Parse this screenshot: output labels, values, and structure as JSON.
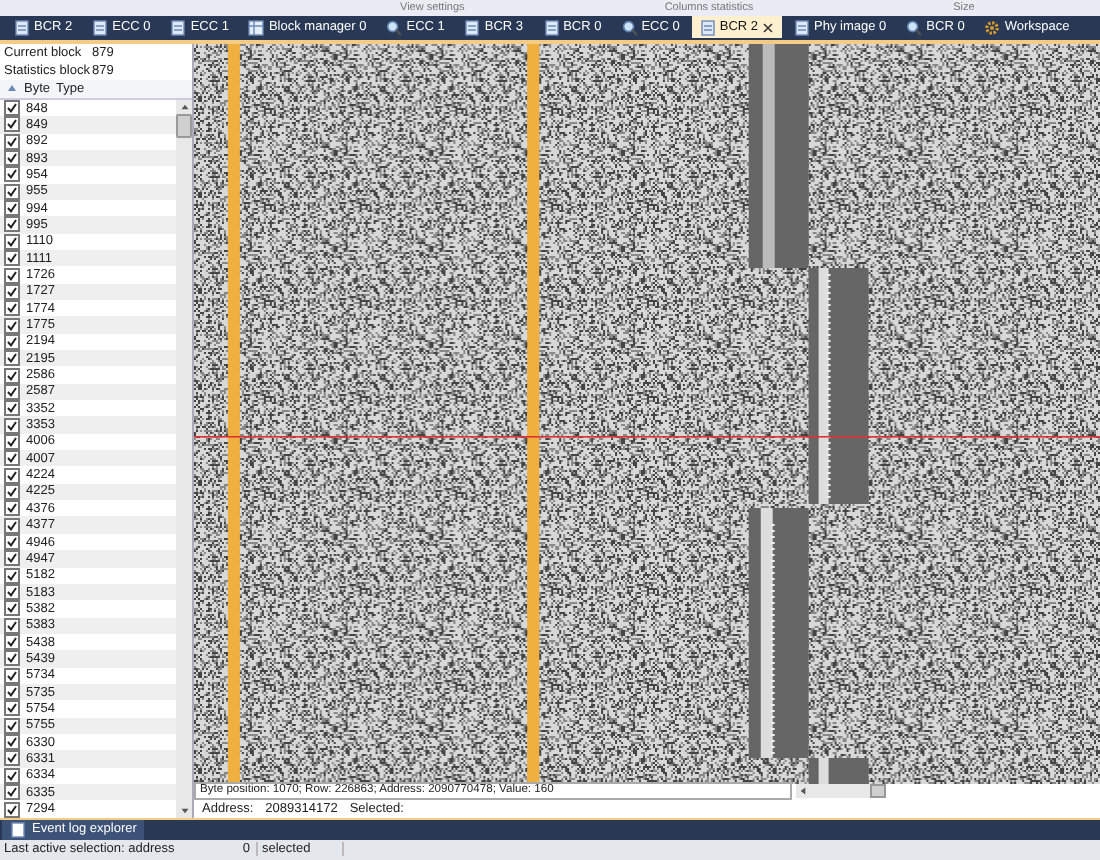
{
  "ribbon_groups": [
    "View settings",
    "Columns statistics",
    "Size"
  ],
  "tabs": [
    {
      "label": "BCR 2",
      "kind": "doc",
      "selected": false
    },
    {
      "label": "ECC 0",
      "kind": "doc",
      "selected": false
    },
    {
      "label": "ECC 1",
      "kind": "doc",
      "selected": false
    },
    {
      "label": "Block manager 0",
      "kind": "block",
      "selected": false
    },
    {
      "label": "ECC 1",
      "kind": "search",
      "selected": false
    },
    {
      "label": "BCR 3",
      "kind": "doc",
      "selected": false
    },
    {
      "label": "BCR 0",
      "kind": "doc",
      "selected": false
    },
    {
      "label": "ECC 0",
      "kind": "search",
      "selected": false
    },
    {
      "label": "BCR 2",
      "kind": "doc",
      "selected": true
    },
    {
      "label": "Phy image 0",
      "kind": "doc",
      "selected": false
    },
    {
      "label": "BCR 0",
      "kind": "search",
      "selected": false
    },
    {
      "label": "Workspace",
      "kind": "gear",
      "selected": false
    }
  ],
  "block_info": [
    {
      "label": "Current block",
      "value": "879"
    },
    {
      "label": "Statistics block",
      "value": "879"
    }
  ],
  "columns": [
    "Byte",
    "Type"
  ],
  "bytes": [
    {
      "value": "848",
      "checked": true
    },
    {
      "value": "849",
      "checked": true
    },
    {
      "value": "892",
      "checked": true
    },
    {
      "value": "893",
      "checked": true
    },
    {
      "value": "954",
      "checked": true
    },
    {
      "value": "955",
      "checked": true
    },
    {
      "value": "994",
      "checked": true
    },
    {
      "value": "995",
      "checked": true
    },
    {
      "value": "1110",
      "checked": true
    },
    {
      "value": "1111",
      "checked": true
    },
    {
      "value": "1726",
      "checked": true
    },
    {
      "value": "1727",
      "checked": true
    },
    {
      "value": "1774",
      "checked": true
    },
    {
      "value": "1775",
      "checked": true
    },
    {
      "value": "2194",
      "checked": true
    },
    {
      "value": "2195",
      "checked": true
    },
    {
      "value": "2586",
      "checked": true
    },
    {
      "value": "2587",
      "checked": true
    },
    {
      "value": "3352",
      "checked": true
    },
    {
      "value": "3353",
      "checked": true
    },
    {
      "value": "4006",
      "checked": true
    },
    {
      "value": "4007",
      "checked": true
    },
    {
      "value": "4224",
      "checked": true
    },
    {
      "value": "4225",
      "checked": true
    },
    {
      "value": "4376",
      "checked": true
    },
    {
      "value": "4377",
      "checked": true
    },
    {
      "value": "4946",
      "checked": true
    },
    {
      "value": "4947",
      "checked": true
    },
    {
      "value": "5182",
      "checked": true
    },
    {
      "value": "5183",
      "checked": true
    },
    {
      "value": "5382",
      "checked": true
    },
    {
      "value": "5383",
      "checked": true
    },
    {
      "value": "5438",
      "checked": true
    },
    {
      "value": "5439",
      "checked": true
    },
    {
      "value": "5734",
      "checked": true
    },
    {
      "value": "5735",
      "checked": true
    },
    {
      "value": "5754",
      "checked": true
    },
    {
      "value": "5755",
      "checked": true
    },
    {
      "value": "6330",
      "checked": true
    },
    {
      "value": "6331",
      "checked": true
    },
    {
      "value": "6334",
      "checked": true
    },
    {
      "value": "6335",
      "checked": true
    },
    {
      "value": "7294",
      "checked": true
    }
  ],
  "info_line": "Byte position: 1070; Row: 226863; Address: 2090770478; Value: 160",
  "address": {
    "label": "Address:",
    "value": "2089314172",
    "selected_label": "Selected:"
  },
  "bottom_tabs": [
    {
      "label": "Event log explorer",
      "selected": true
    }
  ],
  "status_bar": {
    "last_selection": "Last active selection: address",
    "count": "0",
    "count_label": "selected"
  }
}
